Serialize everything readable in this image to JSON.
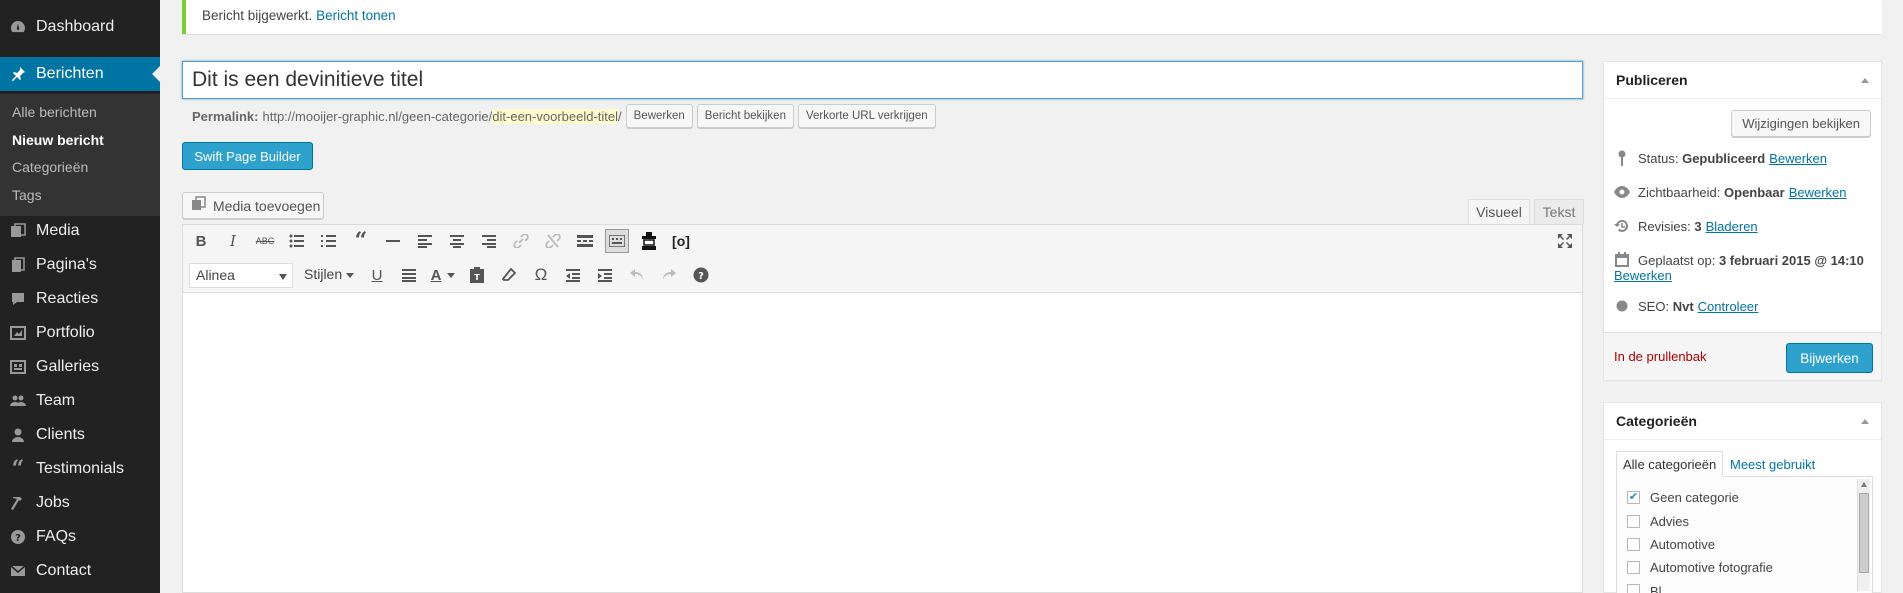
{
  "sidebar": {
    "items": [
      {
        "label": "Dashboard",
        "icon": "dashboard-icon"
      },
      {
        "label": "Berichten",
        "icon": "pin-icon"
      },
      {
        "label": "Media",
        "icon": "media-icon"
      },
      {
        "label": "Pagina's",
        "icon": "pages-icon"
      },
      {
        "label": "Reacties",
        "icon": "comments-icon"
      },
      {
        "label": "Portfolio",
        "icon": "portfolio-icon"
      },
      {
        "label": "Galleries",
        "icon": "gallery-icon"
      },
      {
        "label": "Team",
        "icon": "team-icon"
      },
      {
        "label": "Clients",
        "icon": "user-icon"
      },
      {
        "label": "Testimonials",
        "icon": "quote-icon"
      },
      {
        "label": "Jobs",
        "icon": "hammer-icon"
      },
      {
        "label": "FAQs",
        "icon": "help-icon"
      },
      {
        "label": "Contact",
        "icon": "mail-icon"
      }
    ],
    "submenu": [
      {
        "label": "Alle berichten"
      },
      {
        "label": "Nieuw bericht"
      },
      {
        "label": "Categorieën"
      },
      {
        "label": "Tags"
      }
    ],
    "active_color": "#0074a2"
  },
  "notice": {
    "text": "Bericht bijgewerkt.",
    "link": "Bericht tonen",
    "border_color": "#7ad03a"
  },
  "post": {
    "title": "Dit is een devinitieve titel"
  },
  "permalink": {
    "label": "Permalink:",
    "base": "http://mooijer-graphic.nl/geen-categorie/",
    "slug": "dit-een-voorbeeld-titel",
    "trail": "/",
    "edit_btn": "Bewerken",
    "view_btn": "Bericht bekijken",
    "shortlink_btn": "Verkorte URL verkrijgen"
  },
  "swift_btn": "Swift Page Builder",
  "media_btn": "Media toevoegen",
  "editor": {
    "tab_visual": "Visueel",
    "tab_text": "Tekst",
    "format": "Alinea",
    "styles": "Stijlen"
  },
  "publish": {
    "title": "Publiceren",
    "preview_btn": "Wijzigingen bekijken",
    "status_label": "Status:",
    "status_value": "Gepubliceerd",
    "status_link": "Bewerken",
    "visibility_label": "Zichtbaarheid:",
    "visibility_value": "Openbaar",
    "visibility_link": "Bewerken",
    "revisions_label": "Revisies:",
    "revisions_value": "3",
    "revisions_link": "Bladeren",
    "date_label": "Geplaatst op:",
    "date_value": "3 februari 2015 @ 14:10",
    "date_link": "Bewerken",
    "seo_label": "SEO:",
    "seo_value": "Nvt",
    "seo_link": "Controleer",
    "trash": "In de prullenbak",
    "update_btn": "Bijwerken"
  },
  "categories": {
    "title": "Categorieën",
    "tab_all": "Alle categorieën",
    "tab_popular": "Meest gebruikt",
    "items": [
      {
        "label": "Geen categorie",
        "checked": true
      },
      {
        "label": "Advies",
        "checked": false
      },
      {
        "label": "Automotive",
        "checked": false
      },
      {
        "label": "Automotive fotografie",
        "checked": false
      },
      {
        "label": "Bl",
        "checked": false
      }
    ]
  }
}
